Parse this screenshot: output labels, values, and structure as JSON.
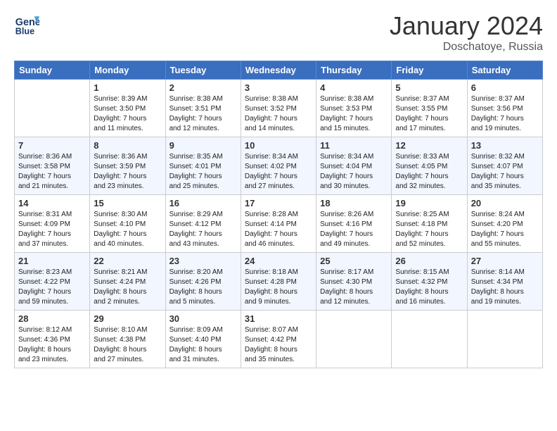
{
  "header": {
    "logo_line1": "General",
    "logo_line2": "Blue",
    "month": "January 2024",
    "location": "Doschatoye, Russia"
  },
  "days_of_week": [
    "Sunday",
    "Monday",
    "Tuesday",
    "Wednesday",
    "Thursday",
    "Friday",
    "Saturday"
  ],
  "weeks": [
    [
      {
        "num": "",
        "info": ""
      },
      {
        "num": "1",
        "info": "Sunrise: 8:39 AM\nSunset: 3:50 PM\nDaylight: 7 hours\nand 11 minutes."
      },
      {
        "num": "2",
        "info": "Sunrise: 8:38 AM\nSunset: 3:51 PM\nDaylight: 7 hours\nand 12 minutes."
      },
      {
        "num": "3",
        "info": "Sunrise: 8:38 AM\nSunset: 3:52 PM\nDaylight: 7 hours\nand 14 minutes."
      },
      {
        "num": "4",
        "info": "Sunrise: 8:38 AM\nSunset: 3:53 PM\nDaylight: 7 hours\nand 15 minutes."
      },
      {
        "num": "5",
        "info": "Sunrise: 8:37 AM\nSunset: 3:55 PM\nDaylight: 7 hours\nand 17 minutes."
      },
      {
        "num": "6",
        "info": "Sunrise: 8:37 AM\nSunset: 3:56 PM\nDaylight: 7 hours\nand 19 minutes."
      }
    ],
    [
      {
        "num": "7",
        "info": "Sunrise: 8:36 AM\nSunset: 3:58 PM\nDaylight: 7 hours\nand 21 minutes."
      },
      {
        "num": "8",
        "info": "Sunrise: 8:36 AM\nSunset: 3:59 PM\nDaylight: 7 hours\nand 23 minutes."
      },
      {
        "num": "9",
        "info": "Sunrise: 8:35 AM\nSunset: 4:01 PM\nDaylight: 7 hours\nand 25 minutes."
      },
      {
        "num": "10",
        "info": "Sunrise: 8:34 AM\nSunset: 4:02 PM\nDaylight: 7 hours\nand 27 minutes."
      },
      {
        "num": "11",
        "info": "Sunrise: 8:34 AM\nSunset: 4:04 PM\nDaylight: 7 hours\nand 30 minutes."
      },
      {
        "num": "12",
        "info": "Sunrise: 8:33 AM\nSunset: 4:05 PM\nDaylight: 7 hours\nand 32 minutes."
      },
      {
        "num": "13",
        "info": "Sunrise: 8:32 AM\nSunset: 4:07 PM\nDaylight: 7 hours\nand 35 minutes."
      }
    ],
    [
      {
        "num": "14",
        "info": "Sunrise: 8:31 AM\nSunset: 4:09 PM\nDaylight: 7 hours\nand 37 minutes."
      },
      {
        "num": "15",
        "info": "Sunrise: 8:30 AM\nSunset: 4:10 PM\nDaylight: 7 hours\nand 40 minutes."
      },
      {
        "num": "16",
        "info": "Sunrise: 8:29 AM\nSunset: 4:12 PM\nDaylight: 7 hours\nand 43 minutes."
      },
      {
        "num": "17",
        "info": "Sunrise: 8:28 AM\nSunset: 4:14 PM\nDaylight: 7 hours\nand 46 minutes."
      },
      {
        "num": "18",
        "info": "Sunrise: 8:26 AM\nSunset: 4:16 PM\nDaylight: 7 hours\nand 49 minutes."
      },
      {
        "num": "19",
        "info": "Sunrise: 8:25 AM\nSunset: 4:18 PM\nDaylight: 7 hours\nand 52 minutes."
      },
      {
        "num": "20",
        "info": "Sunrise: 8:24 AM\nSunset: 4:20 PM\nDaylight: 7 hours\nand 55 minutes."
      }
    ],
    [
      {
        "num": "21",
        "info": "Sunrise: 8:23 AM\nSunset: 4:22 PM\nDaylight: 7 hours\nand 59 minutes."
      },
      {
        "num": "22",
        "info": "Sunrise: 8:21 AM\nSunset: 4:24 PM\nDaylight: 8 hours\nand 2 minutes."
      },
      {
        "num": "23",
        "info": "Sunrise: 8:20 AM\nSunset: 4:26 PM\nDaylight: 8 hours\nand 5 minutes."
      },
      {
        "num": "24",
        "info": "Sunrise: 8:18 AM\nSunset: 4:28 PM\nDaylight: 8 hours\nand 9 minutes."
      },
      {
        "num": "25",
        "info": "Sunrise: 8:17 AM\nSunset: 4:30 PM\nDaylight: 8 hours\nand 12 minutes."
      },
      {
        "num": "26",
        "info": "Sunrise: 8:15 AM\nSunset: 4:32 PM\nDaylight: 8 hours\nand 16 minutes."
      },
      {
        "num": "27",
        "info": "Sunrise: 8:14 AM\nSunset: 4:34 PM\nDaylight: 8 hours\nand 19 minutes."
      }
    ],
    [
      {
        "num": "28",
        "info": "Sunrise: 8:12 AM\nSunset: 4:36 PM\nDaylight: 8 hours\nand 23 minutes."
      },
      {
        "num": "29",
        "info": "Sunrise: 8:10 AM\nSunset: 4:38 PM\nDaylight: 8 hours\nand 27 minutes."
      },
      {
        "num": "30",
        "info": "Sunrise: 8:09 AM\nSunset: 4:40 PM\nDaylight: 8 hours\nand 31 minutes."
      },
      {
        "num": "31",
        "info": "Sunrise: 8:07 AM\nSunset: 4:42 PM\nDaylight: 8 hours\nand 35 minutes."
      },
      {
        "num": "",
        "info": ""
      },
      {
        "num": "",
        "info": ""
      },
      {
        "num": "",
        "info": ""
      }
    ]
  ]
}
